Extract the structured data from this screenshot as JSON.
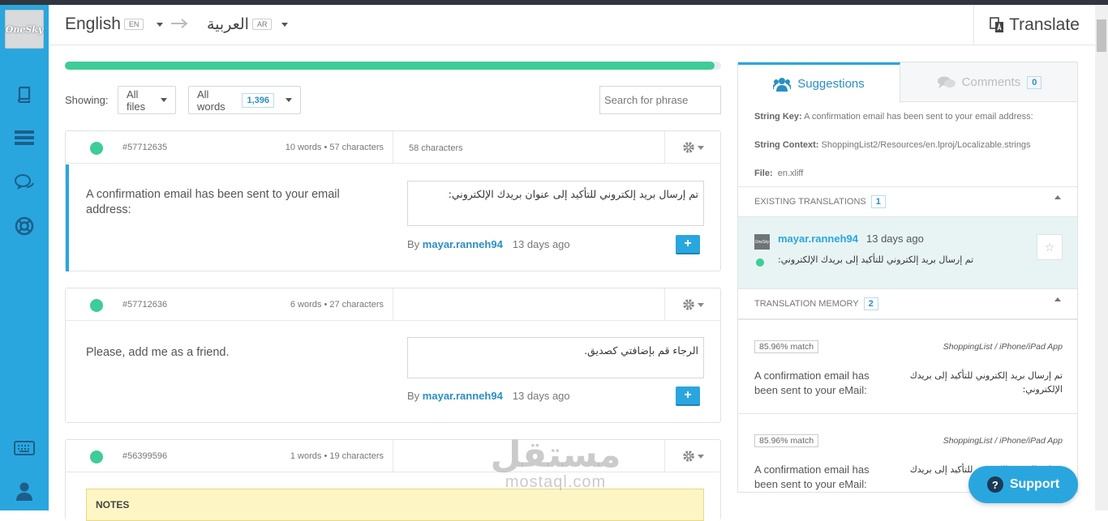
{
  "brand": {
    "logo_text": "OneSky"
  },
  "topbar": {
    "source_lang": "English",
    "source_code": "EN",
    "target_lang": "العربية",
    "target_code": "AR",
    "translate_label": "Translate"
  },
  "progress": {
    "percent": 99
  },
  "filters": {
    "showing_label": "Showing:",
    "files": "All files",
    "words": "All words",
    "words_count": "1,396",
    "search_placeholder": "Search for phrase"
  },
  "strings": [
    {
      "id": "#57712635",
      "meta": "10 words • 57 characters",
      "target_chars": "58 characters",
      "source": "A confirmation email has been sent to your email address:",
      "translation": "تم إرسال بريد إلكتروني للتأكيد إلى عنوان بريدك الإلكتروني:",
      "by_label": "By",
      "author": "mayar.ranneh94",
      "ago": "13 days ago"
    },
    {
      "id": "#57712636",
      "meta": "6 words • 27 characters",
      "target_chars": "",
      "source": "Please, add me as a friend.",
      "translation": "الرجاء قم بإضافتي كصديق.",
      "by_label": "By",
      "author": "mayar.ranneh94",
      "ago": "13 days ago"
    },
    {
      "id": "#56399596",
      "meta": "1 words • 19 characters",
      "target_chars": "",
      "notes_label": "NOTES"
    }
  ],
  "panel": {
    "tab_suggestions": "Suggestions",
    "tab_comments": "Comments",
    "comments_count": "0",
    "string_key_label": "String Key:",
    "string_key": "A confirmation email has been sent to your email address:",
    "string_context_label": "String Context:",
    "string_context": "ShoppingList2/Resources/en.lproj/Localizable.strings",
    "file_label": "File:",
    "file": "en.xliff",
    "existing_label": "EXISTING TRANSLATIONS",
    "existing_count": "1",
    "existing": {
      "avatar_text": "OneSky",
      "user": "mayar.ranneh94",
      "ago": "13 days ago",
      "text": "تم إرسال بريد إلكتروني للتأكيد إلى بريدك الإلكتروني:"
    },
    "tm_label": "TRANSLATION MEMORY",
    "tm_count": "2",
    "tm": [
      {
        "match": "85.96% match",
        "source": "ShoppingList / iPhone/iPad App",
        "en": "A confirmation email has been sent to your eMail:",
        "ar": "تم إرسال بريد إلكتروني للتأكيد إلى بريدك الإلكتروني:"
      },
      {
        "match": "85.96% match",
        "source": "ShoppingList / iPhone/iPad App",
        "en": "A confirmation email has been sent to your eMail:",
        "ar": "تم إرسال بريد إلكتروني للتأكيد إلى بريدك الإلكتروني:"
      }
    ]
  },
  "support": {
    "label": "Support",
    "icon": "?"
  },
  "watermark": {
    "arabic": "مستقل",
    "latin": "mostaql.com"
  }
}
